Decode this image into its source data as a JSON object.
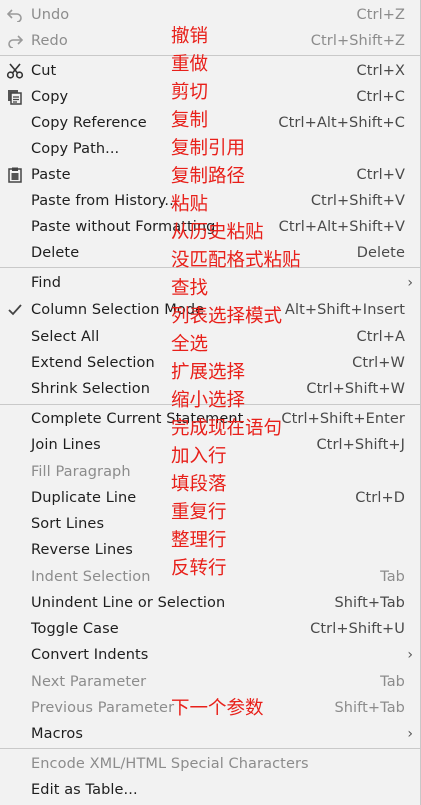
{
  "menu": {
    "items": [
      {
        "label": "Undo",
        "shortcut": "Ctrl+Z",
        "disabled": true,
        "icon": "undo-icon"
      },
      {
        "label": "Redo",
        "shortcut": "Ctrl+Shift+Z",
        "disabled": true,
        "icon": "redo-icon"
      },
      {
        "label": "Cut",
        "shortcut": "Ctrl+X",
        "icon": "scissors-icon"
      },
      {
        "label": "Copy",
        "shortcut": "Ctrl+C",
        "icon": "copy-icon"
      },
      {
        "label": "Copy Reference",
        "shortcut": "Ctrl+Alt+Shift+C"
      },
      {
        "label": "Copy Path...",
        "shortcut": ""
      },
      {
        "label": "Paste",
        "shortcut": "Ctrl+V",
        "icon": "clipboard-icon"
      },
      {
        "label": "Paste from History...",
        "shortcut": "Ctrl+Shift+V"
      },
      {
        "label": "Paste without Formatting",
        "shortcut": "Ctrl+Alt+Shift+V"
      },
      {
        "label": "Delete",
        "shortcut": "Delete"
      },
      {
        "label": "Find",
        "shortcut": "",
        "submenu": true
      },
      {
        "label": "Column Selection Mode",
        "shortcut": "Alt+Shift+Insert",
        "checked": true
      },
      {
        "label": "Select All",
        "shortcut": "Ctrl+A"
      },
      {
        "label": "Extend Selection",
        "shortcut": "Ctrl+W"
      },
      {
        "label": "Shrink Selection",
        "shortcut": "Ctrl+Shift+W"
      },
      {
        "label": "Complete Current Statement",
        "shortcut": "Ctrl+Shift+Enter"
      },
      {
        "label": "Join Lines",
        "shortcut": "Ctrl+Shift+J"
      },
      {
        "label": "Fill Paragraph",
        "shortcut": "",
        "disabled": true
      },
      {
        "label": "Duplicate Line",
        "shortcut": "Ctrl+D"
      },
      {
        "label": "Sort Lines",
        "shortcut": ""
      },
      {
        "label": "Reverse Lines",
        "shortcut": ""
      },
      {
        "label": "Indent Selection",
        "shortcut": "Tab",
        "disabled": true
      },
      {
        "label": "Unindent Line or Selection",
        "shortcut": "Shift+Tab"
      },
      {
        "label": "Toggle Case",
        "shortcut": "Ctrl+Shift+U"
      },
      {
        "label": "Convert Indents",
        "shortcut": "",
        "submenu": true
      },
      {
        "label": "Next Parameter",
        "shortcut": "Tab",
        "disabled": true
      },
      {
        "label": "Previous Parameter",
        "shortcut": "Shift+Tab",
        "disabled": true
      },
      {
        "label": "Macros",
        "shortcut": "",
        "submenu": true
      },
      {
        "label": "Encode XML/HTML Special Characters",
        "shortcut": "",
        "disabled": true
      },
      {
        "label": "Edit as Table...",
        "shortcut": ""
      }
    ]
  },
  "annotations": [
    "撤销",
    "重做",
    "剪切",
    "复制",
    "复制引用",
    "复制路径",
    "粘贴",
    "从历史粘贴",
    "没匹配格式粘贴",
    "查找",
    "列表选择模式",
    "全选",
    "扩展选择",
    "缩小选择",
    "完成现在语句",
    "加入行",
    "填段落",
    "重复行",
    "整理行",
    "反转行",
    "下一个参数"
  ],
  "colors": {
    "annotation": "#e8201a",
    "text": "#1e1e1e",
    "disabled": "#8c8c8c",
    "background": "#f2f2f2"
  }
}
